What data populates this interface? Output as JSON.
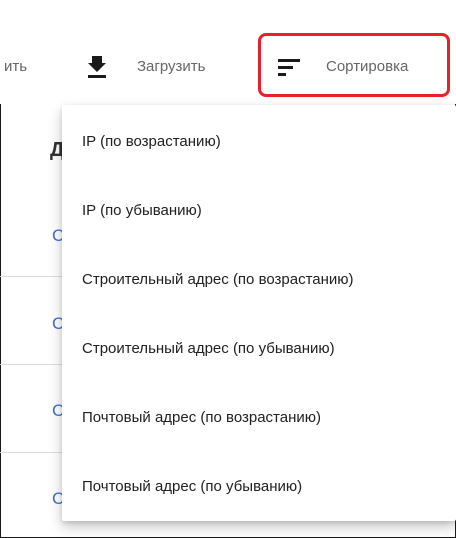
{
  "toolbar": {
    "truncated_label": "ить",
    "download_label": "Загрузить",
    "sort_label": "Сортировка",
    "download_icon": "download-icon",
    "sort_icon": "sort-icon"
  },
  "sort_menu": {
    "items": [
      {
        "label": "IP (по возрастанию)"
      },
      {
        "label": "IP (по убыванию)"
      },
      {
        "label": "Строительный адрес (по возрастанию)"
      },
      {
        "label": "Строительный адрес (по убыванию)"
      },
      {
        "label": "Почтовый адрес (по возрастанию)"
      },
      {
        "label": "Почтовый адрес (по убыванию)"
      }
    ]
  },
  "table_peek": {
    "header_glyph": "Д",
    "row_glyphs": [
      "С",
      "С",
      "С",
      "С"
    ]
  },
  "colors": {
    "highlight": "#e8202a",
    "link": "#3f6fd1",
    "text": "#212121",
    "muted": "#666666"
  }
}
